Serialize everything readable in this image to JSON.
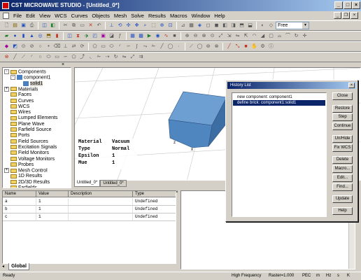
{
  "window": {
    "title": "CST MICROWAVE STUDIO - [Untitled_0*]",
    "minimize": "_",
    "maximize": "□",
    "close": "×"
  },
  "menu": [
    "File",
    "Edit",
    "View",
    "WCS",
    "Curves",
    "Objects",
    "Mesh",
    "Solve",
    "Results",
    "Macros",
    "Window",
    "Help"
  ],
  "toolbar": {
    "view_mode": "Free"
  },
  "tree": {
    "close_glyph": "×",
    "items": [
      {
        "label": "Components",
        "icon": "folder-icon",
        "expander": "-",
        "level": 0
      },
      {
        "label": "component1",
        "icon": "component-icon",
        "expander": "-",
        "level": 1
      },
      {
        "label": "solid1",
        "icon": "solid-icon",
        "expander": "",
        "level": 2
      },
      {
        "label": "Materials",
        "icon": "folder-icon",
        "expander": "+",
        "level": 0
      },
      {
        "label": "Faces",
        "icon": "folder-icon",
        "expander": "",
        "level": 0
      },
      {
        "label": "Curves",
        "icon": "folder-icon",
        "expander": "",
        "level": 0
      },
      {
        "label": "WCS",
        "icon": "folder-icon",
        "expander": "",
        "level": 0
      },
      {
        "label": "Wires",
        "icon": "folder-icon",
        "expander": "",
        "level": 0
      },
      {
        "label": "Lumped Elements",
        "icon": "folder-icon",
        "expander": "",
        "level": 0
      },
      {
        "label": "Plane Wave",
        "icon": "folder-icon",
        "expander": "",
        "level": 0
      },
      {
        "label": "Farfield Source",
        "icon": "folder-icon",
        "expander": "",
        "level": 0
      },
      {
        "label": "Ports",
        "icon": "folder-icon",
        "expander": "",
        "level": 0
      },
      {
        "label": "Field Sources",
        "icon": "folder-icon",
        "expander": "",
        "level": 0
      },
      {
        "label": "Excitation Signals",
        "icon": "folder-icon",
        "expander": "",
        "level": 0
      },
      {
        "label": "Field Monitors",
        "icon": "folder-icon",
        "expander": "",
        "level": 0
      },
      {
        "label": "Voltage Monitors",
        "icon": "folder-icon",
        "expander": "",
        "level": 0
      },
      {
        "label": "Probes",
        "icon": "folder-icon",
        "expander": "",
        "level": 0
      },
      {
        "label": "Mesh Control",
        "icon": "folder-icon",
        "expander": "+",
        "level": 0
      },
      {
        "label": "1D Results",
        "icon": "folder-icon",
        "expander": "",
        "level": 0
      },
      {
        "label": "2D/3D Results",
        "icon": "folder-icon",
        "expander": "",
        "level": 0
      },
      {
        "label": "Farfields",
        "icon": "folder-icon",
        "expander": "",
        "level": 0
      }
    ]
  },
  "material_info": [
    {
      "key": "Material",
      "value": "Vacuum"
    },
    {
      "key": "Type",
      "value": "Normal"
    },
    {
      "key": "Epsilon",
      "value": "1"
    },
    {
      "key": "Mue",
      "value": "1"
    }
  ],
  "view_tabs": [
    "Untitled_0*",
    "Untitled_0*"
  ],
  "params": {
    "columns": [
      "Name",
      "Value",
      "Description",
      "Type"
    ],
    "rows": [
      [
        "a",
        "1",
        "",
        "Undefined"
      ],
      [
        "b",
        "1",
        "",
        "Undefined"
      ],
      [
        "c",
        "1",
        "",
        "Undefined"
      ]
    ],
    "tab": "Global"
  },
  "history": {
    "title": "History List",
    "items": [
      {
        "label": "new component: component1",
        "selected": false
      },
      {
        "label": "define brick: component1:solid1",
        "selected": true
      }
    ],
    "buttons": [
      "Close",
      "Restore",
      "Step",
      "Continue",
      "Un/Hide",
      "Fix WCS",
      "Delete",
      "Macro...",
      "Edit...",
      "Find...",
      "Update",
      "Help"
    ]
  },
  "status": {
    "left": "Ready",
    "mode": "High Frequency",
    "raster": "Raster=1.000",
    "pec": "PEC",
    "units": [
      "m",
      "Hz",
      "s",
      "K"
    ]
  },
  "colors": {
    "titlebar_start": "#0a246a",
    "titlebar_end": "#a6caf0",
    "brick_front": "#4f86c0",
    "brick_top": "#6e9fd2",
    "brick_side": "#3d6ea3"
  }
}
